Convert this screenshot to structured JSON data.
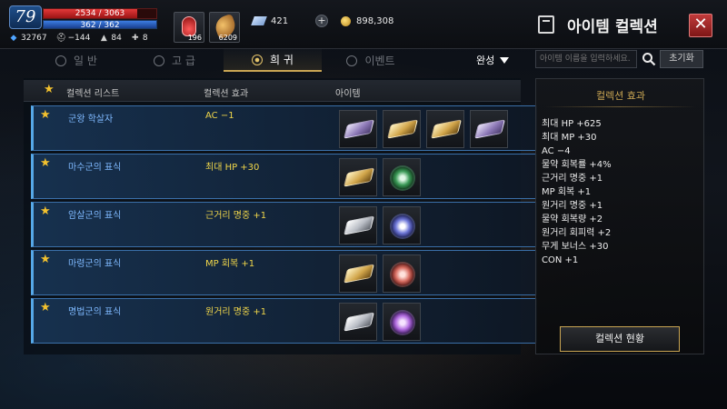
{
  "player": {
    "level": "79",
    "hp": {
      "text": "2534 / 3063",
      "fraction": 0.827
    },
    "mp": {
      "text": "362 / 362",
      "fraction": 1.0
    },
    "stats": [
      {
        "icon": "gem-icon",
        "value": "32767"
      },
      {
        "icon": "helmet-icon",
        "value": "−144"
      },
      {
        "icon": "boots-icon",
        "value": "84"
      },
      {
        "icon": "cross-icon",
        "value": "8"
      }
    ]
  },
  "quick_items": [
    {
      "icon": "red-potion-icon",
      "count": "196"
    },
    {
      "icon": "feather-scroll-icon",
      "count": "6209"
    }
  ],
  "currency": {
    "diamond": "421",
    "gold": "898,308"
  },
  "header": {
    "title": "아이템 컬렉션",
    "close": "✕"
  },
  "tabs": [
    {
      "label": "일 반",
      "active": false
    },
    {
      "label": "고 급",
      "active": false
    },
    {
      "label": "희 귀",
      "active": true
    },
    {
      "label": "이벤트",
      "active": false
    }
  ],
  "sort": {
    "label": "완성"
  },
  "search": {
    "placeholder": "아이템 이름을 입력하세요.",
    "reset_label": "초기화"
  },
  "list": {
    "headers": {
      "name": "컬렉션 리스트",
      "effect": "컬렉션 효과",
      "items": "아이템"
    },
    "rows": [
      {
        "name": "군왕 학살자",
        "effect": "AC −1",
        "items": [
          "purple-plate-icon",
          "gold-plate-icon",
          "gold-plate-icon",
          "purple-plate-icon"
        ]
      },
      {
        "name": "마수군의 표식",
        "effect": "최대 HP +30",
        "items": [
          "gold-plate-icon",
          "green-gear-icon"
        ]
      },
      {
        "name": "암살군의 표식",
        "effect": "근거리 명중 +1",
        "items": [
          "silver-plate-icon",
          "blue-gear-icon"
        ]
      },
      {
        "name": "마령군의 표식",
        "effect": "MP 회복 +1",
        "items": [
          "gold-plate-icon",
          "red-gear-icon"
        ]
      },
      {
        "name": "명법군의 표식",
        "effect": "원거리 명중 +1",
        "items": [
          "silver-plate-icon",
          "violet-gear-icon"
        ]
      }
    ]
  },
  "effects": {
    "title": "컬렉션 효과",
    "items": [
      "최대 HP +625",
      "최대 MP +30",
      "AC −4",
      "물약 회복률 +4%",
      "근거리 명중 +1",
      "MP 회복 +1",
      "원거리 명중 +1",
      "물약 회복량 +2",
      "원거리 회피력 +2",
      "무게 보너스 +30",
      "CON +1"
    ],
    "status_button": "컬렉션 현황"
  }
}
